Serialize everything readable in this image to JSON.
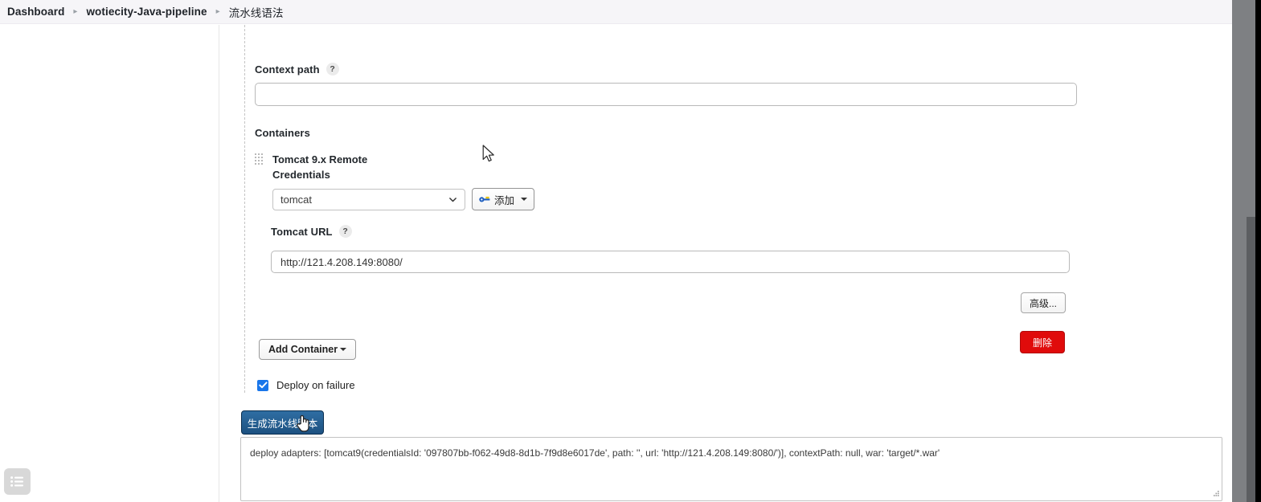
{
  "breadcrumb": {
    "items": [
      {
        "label": "Dashboard"
      },
      {
        "label": "wotiecity-Java-pipeline"
      },
      {
        "label": "流水线语法"
      }
    ],
    "separator": "▸"
  },
  "form": {
    "context_path": {
      "label": "Context path",
      "help": "?",
      "value": "",
      "placeholder": ""
    },
    "containers_label": "Containers",
    "container": {
      "title": "Tomcat 9.x Remote",
      "credentials_label": "Credentials",
      "credentials_value": "tomcat",
      "add_credentials_label": "添加",
      "url_label": "Tomcat URL",
      "url_help": "?",
      "url_value": "http://121.4.208.149:8080/",
      "advanced_label": "高级...",
      "delete_label": "删除"
    },
    "add_container_label": "Add Container",
    "deploy_on_failure": {
      "label": "Deploy on failure",
      "checked": true
    },
    "generate_label": "生成流水线脚本",
    "script_output": "deploy adapters: [tomcat9(credentialsId: '097807bb-f062-49d8-8d1b-7f9d8e6017de', path: '', url: 'http://121.4.208.149:8080/')], contextPath: null, war: 'target/*.war'"
  },
  "colors": {
    "primary_button": "#1d5181",
    "danger_button": "#e00b0b",
    "checkbox_accent": "#1976ea",
    "breadcrumb_bg": "#f6f5f8",
    "gutter": "#7e8083"
  },
  "icons": {
    "rail_menu": "list-icon",
    "drag_grip": "drag-handle-icon",
    "key": "key-icon",
    "chevron": "chevron-down-icon",
    "caret": "caret-down-icon",
    "check": "check-icon"
  }
}
